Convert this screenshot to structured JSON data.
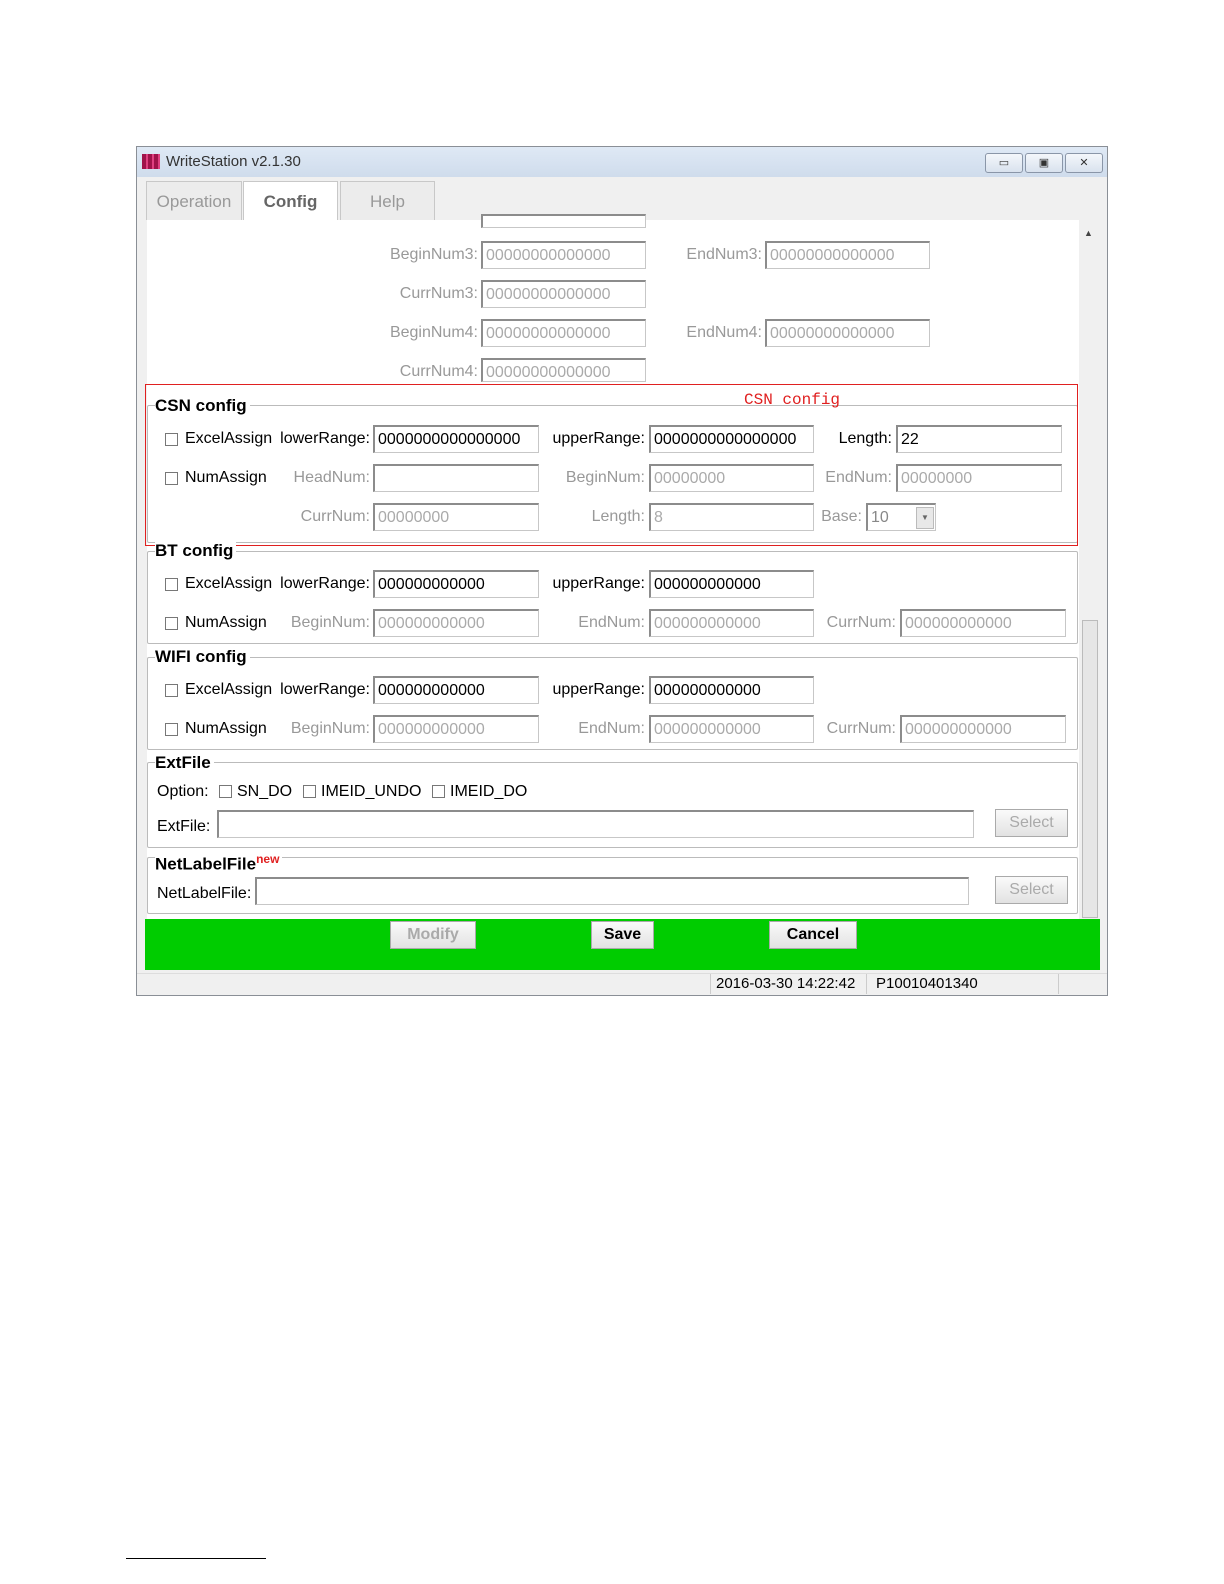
{
  "window": {
    "title": "WriteStation v2.1.30",
    "icon": "app-icon",
    "controls": [
      "minimize-icon",
      "maximize-icon",
      "close-icon"
    ]
  },
  "tabs": [
    {
      "label": "Operation"
    },
    {
      "label": "Config",
      "active": true
    },
    {
      "label": "Help"
    }
  ],
  "num_fields": {
    "begin3": {
      "label": "BeginNum3:",
      "value": "00000000000000"
    },
    "end3": {
      "label": "EndNum3:",
      "value": "00000000000000"
    },
    "curr3": {
      "label": "CurrNum3:",
      "value": "00000000000000"
    },
    "begin4": {
      "label": "BeginNum4:",
      "value": "00000000000000"
    },
    "end4": {
      "label": "EndNum4:",
      "value": "00000000000000"
    },
    "curr4": {
      "label": "CurrNum4:",
      "value": "00000000000000"
    }
  },
  "annotation": {
    "label": "CSN config",
    "color": "#e02020"
  },
  "csn": {
    "title": "CSN config",
    "excel_assign": "ExcelAssign",
    "lower_label": "lowerRange:",
    "lower_value": "0000000000000000",
    "upper_label": "upperRange:",
    "upper_value": "0000000000000000",
    "length_label": "Length:",
    "length_value": "22",
    "num_assign": "NumAssign",
    "head_label": "HeadNum:",
    "head_value": "",
    "begin_label": "BeginNum:",
    "begin_value": "00000000",
    "end_label": "EndNum:",
    "end_value": "00000000",
    "curr_label": "CurrNum:",
    "curr_value": "00000000",
    "len2_label": "Length:",
    "len2_value": "8",
    "base_label": "Base:",
    "base_value": "10"
  },
  "bt": {
    "title": "BT config",
    "excel_assign": "ExcelAssign",
    "lower_label": "lowerRange:",
    "lower_value": "000000000000",
    "upper_label": "upperRange:",
    "upper_value": "000000000000",
    "num_assign": "NumAssign",
    "begin_label": "BeginNum:",
    "begin_value": "000000000000",
    "end_label": "EndNum:",
    "end_value": "000000000000",
    "curr_label": "CurrNum:",
    "curr_value": "000000000000"
  },
  "wifi": {
    "title": "WIFI config",
    "excel_assign": "ExcelAssign",
    "lower_label": "lowerRange:",
    "lower_value": "000000000000",
    "upper_label": "upperRange:",
    "upper_value": "000000000000",
    "num_assign": "NumAssign",
    "begin_label": "BeginNum:",
    "begin_value": "000000000000",
    "end_label": "EndNum:",
    "end_value": "000000000000",
    "curr_label": "CurrNum:",
    "curr_value": "000000000000"
  },
  "extfile": {
    "title": "ExtFile",
    "option_label": "Option:",
    "options": [
      "SN_DO",
      "IMEID_UNDO",
      "IMEID_DO"
    ],
    "file_label": "ExtFile:",
    "file_value": "",
    "select": "Select"
  },
  "netlabel": {
    "title": "NetLabelFile",
    "badge": "new",
    "file_label": "NetLabelFile:",
    "file_value": "",
    "select": "Select"
  },
  "actions": {
    "modify": "Modify",
    "save": "Save",
    "cancel": "Cancel",
    "bar_color": "#00cc00"
  },
  "status": {
    "datetime": "2016-03-30 14:22:42",
    "id": "P10010401340"
  }
}
